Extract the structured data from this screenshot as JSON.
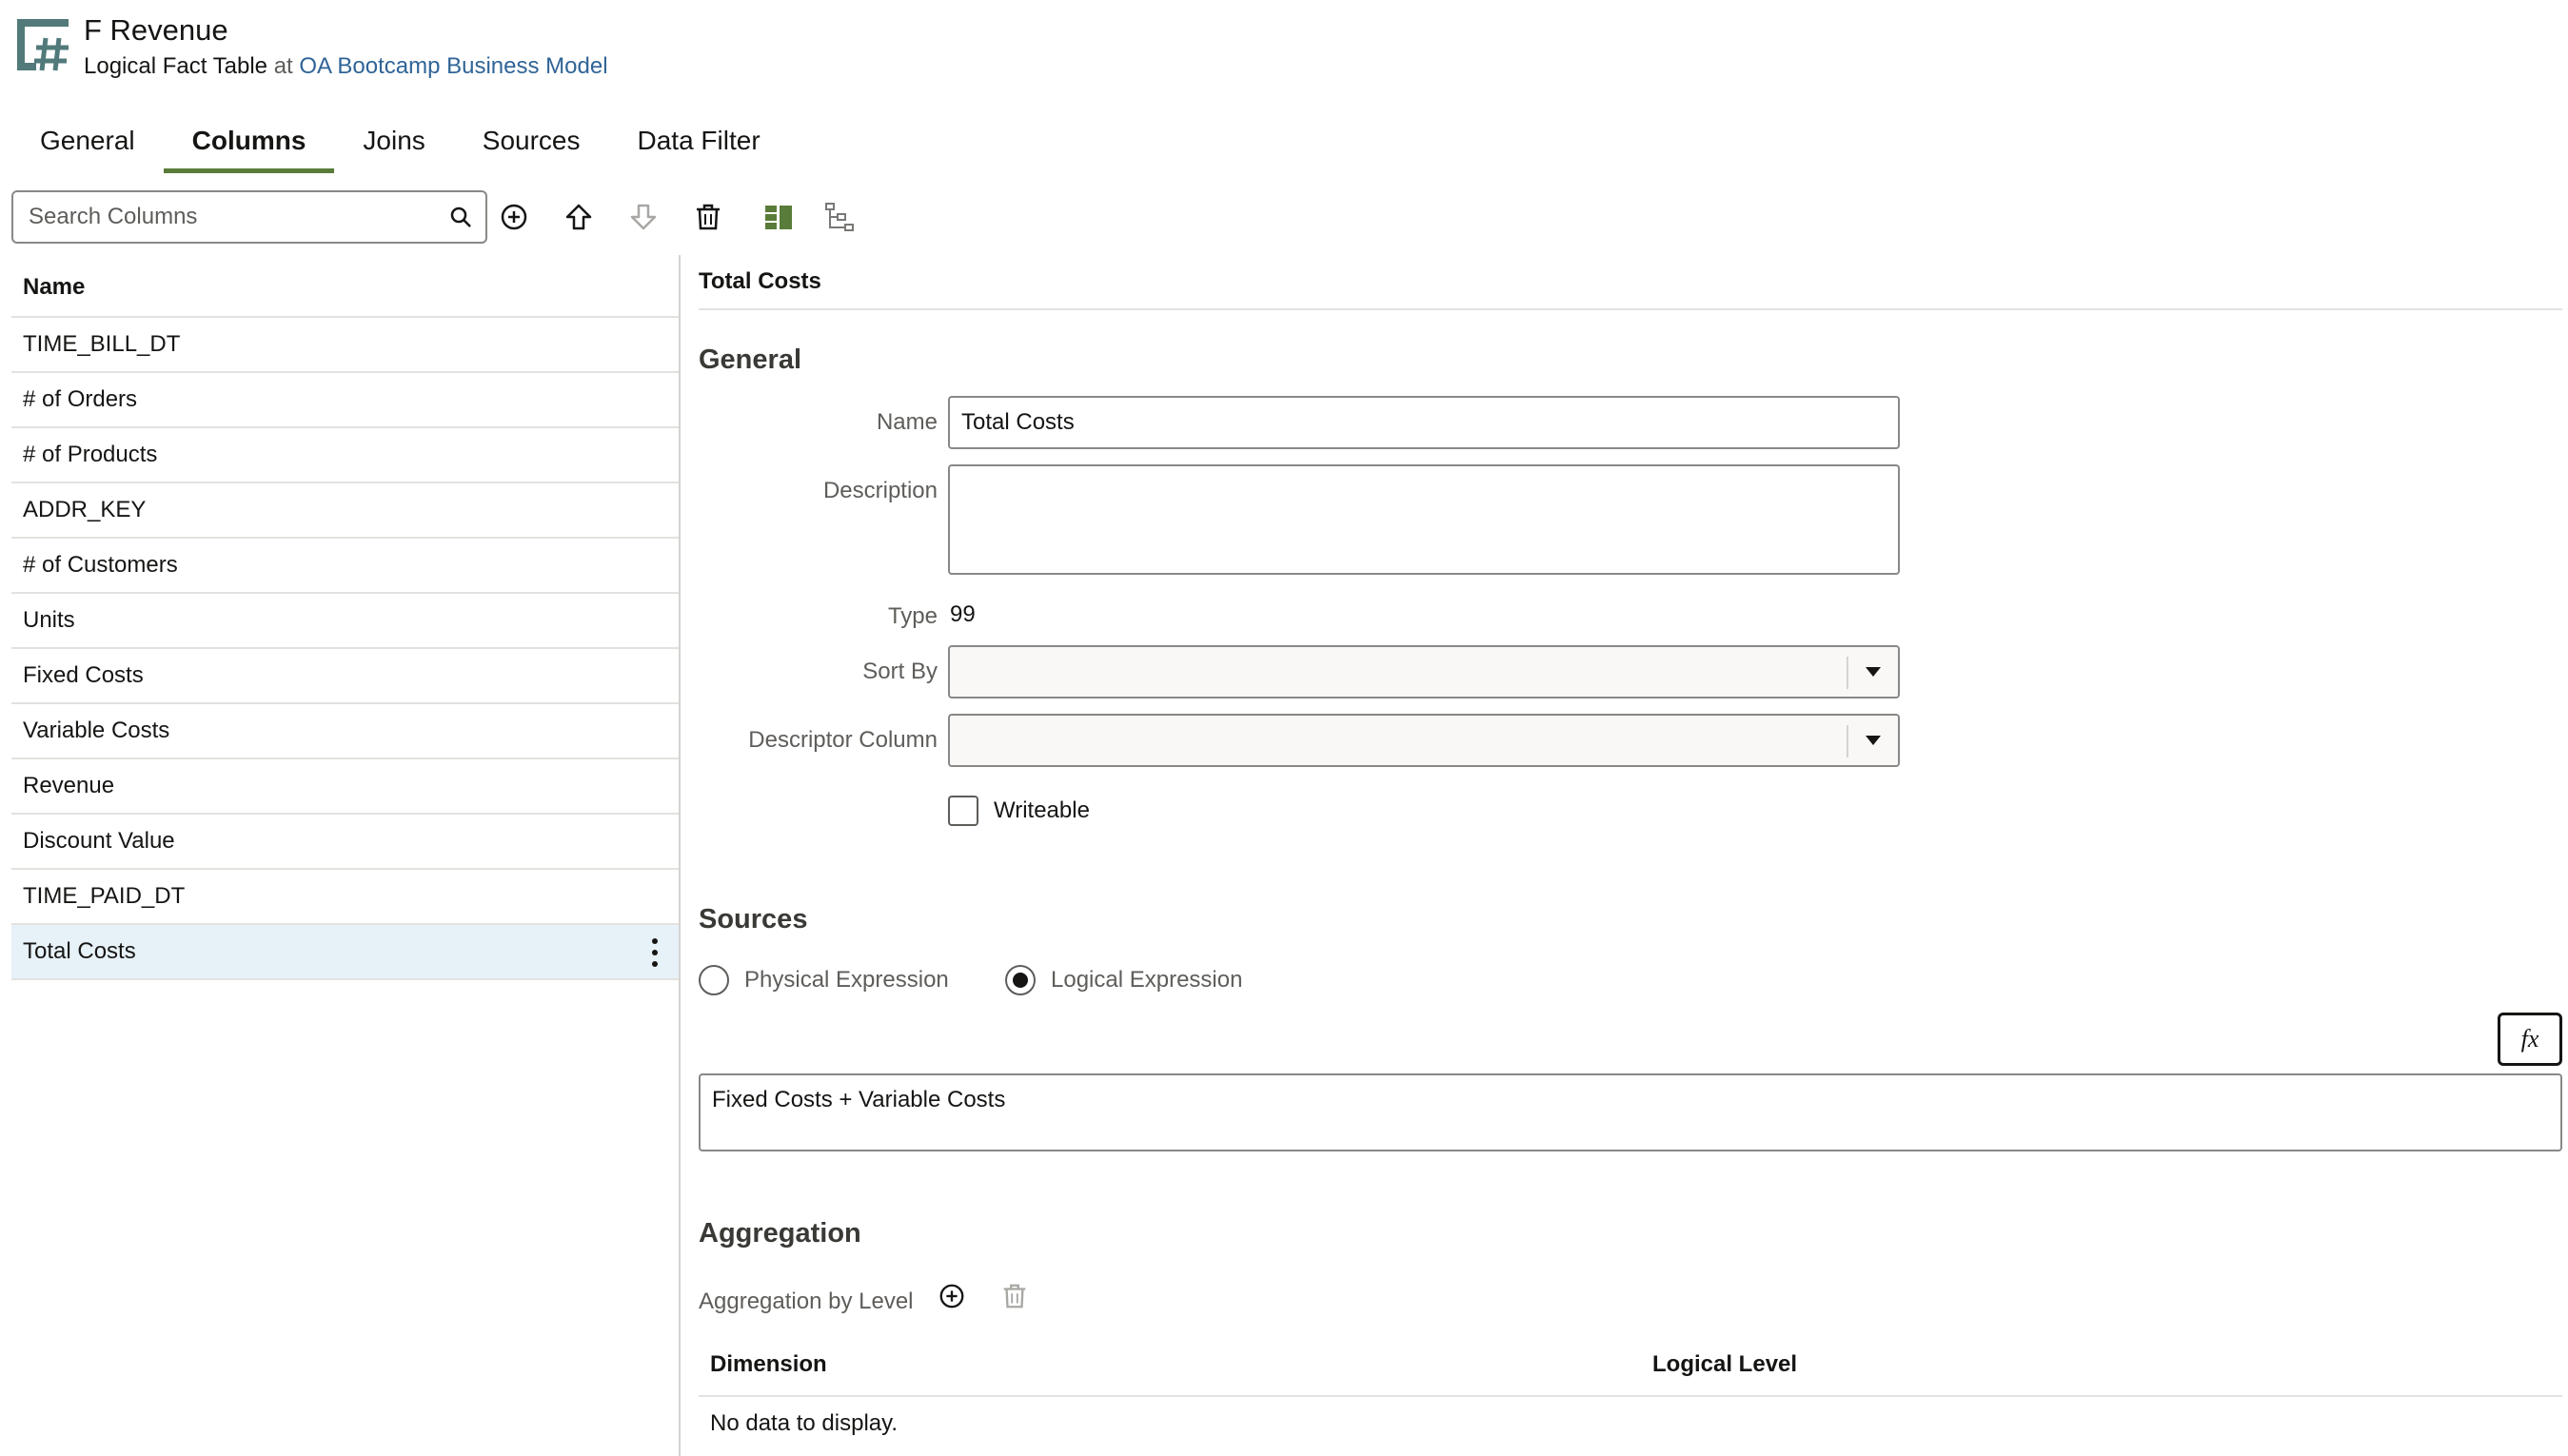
{
  "header": {
    "title": "F Revenue",
    "subtitle_type": "Logical Fact Table",
    "subtitle_at": "at",
    "subtitle_link": "OA Bootcamp Business Model"
  },
  "tabs": [
    {
      "label": "General",
      "active": false
    },
    {
      "label": "Columns",
      "active": true
    },
    {
      "label": "Joins",
      "active": false
    },
    {
      "label": "Sources",
      "active": false
    },
    {
      "label": "Data Filter",
      "active": false
    }
  ],
  "toolbar": {
    "search_placeholder": "Search Columns"
  },
  "columns_list": {
    "header": "Name",
    "items": [
      "TIME_BILL_DT",
      "# of Orders",
      "# of Products",
      "ADDR_KEY",
      "# of Customers",
      "Units",
      "Fixed Costs",
      "Variable Costs",
      "Revenue",
      "Discount Value",
      "TIME_PAID_DT",
      "Total Costs"
    ],
    "selected_index": 11
  },
  "detail": {
    "title": "Total Costs",
    "general": {
      "heading": "General",
      "name_label": "Name",
      "name_value": "Total Costs",
      "description_label": "Description",
      "description_value": "",
      "type_label": "Type",
      "type_value": "99",
      "sort_by_label": "Sort By",
      "sort_by_value": "",
      "descriptor_label": "Descriptor Column",
      "descriptor_value": "",
      "writeable_label": "Writeable",
      "writeable_checked": false
    },
    "sources": {
      "heading": "Sources",
      "physical_label": "Physical Expression",
      "logical_label": "Logical Expression",
      "selected": "logical",
      "fx_label": "fx",
      "expression": "Fixed Costs + Variable Costs"
    },
    "aggregation": {
      "heading": "Aggregation",
      "by_level_label": "Aggregation by Level",
      "col_dimension": "Dimension",
      "col_logical_level": "Logical Level",
      "empty_text": "No data to display."
    }
  },
  "colors": {
    "accent_green": "#5a7c3a",
    "link_blue": "#2f6497",
    "selected_row": "#e7f1f8",
    "header_icon": "#527a7a"
  }
}
